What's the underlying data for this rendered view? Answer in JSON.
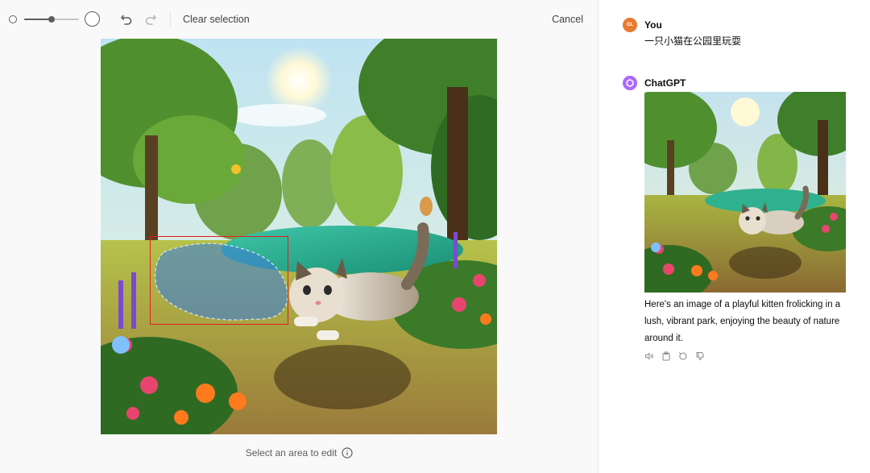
{
  "toolbar": {
    "brush_size": 0.5,
    "clear_label": "Clear selection",
    "cancel_label": "Cancel",
    "icons": {
      "brush_small": "small-circle-icon",
      "brush_large": "large-circle-icon",
      "undo": "undo-icon",
      "redo": "redo-icon"
    }
  },
  "editor": {
    "image_description_icon": "kitten-park-image",
    "hint_label": "Select an area to edit",
    "hint_icon": "info-icon",
    "selection_color": "#e02020",
    "mask_color": "#3d7fd6"
  },
  "conversation": {
    "user": {
      "initials": "GL",
      "name": "You",
      "message": "一只小猫在公园里玩耍",
      "avatar_color": "#e87a2f"
    },
    "assistant": {
      "name": "ChatGPT",
      "avatar_color": "#ab68ff",
      "avatar_icon": "openai-logo-icon",
      "reply": "Here's an image of a playful kitten frolicking in a lush, vibrant park, enjoying the beauty of nature around it.",
      "action_icons": [
        "read-aloud-icon",
        "copy-icon",
        "regenerate-icon",
        "thumbs-down-icon"
      ]
    }
  }
}
